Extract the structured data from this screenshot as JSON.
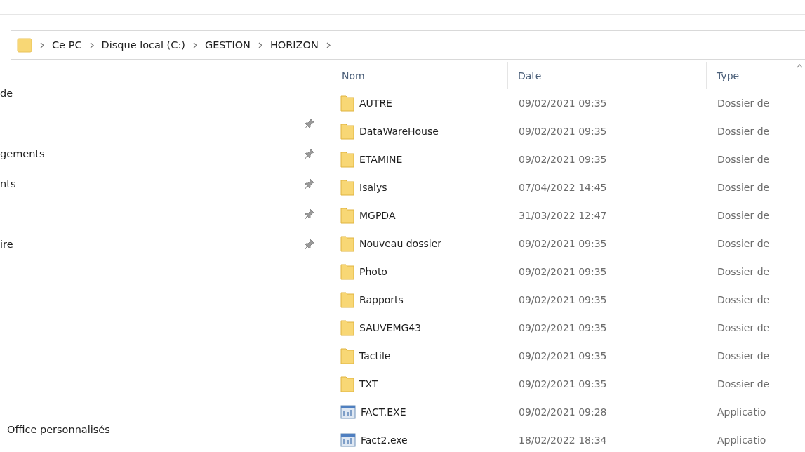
{
  "address_bar": {
    "path": [
      "Ce PC",
      "Disque local (C:)",
      "GESTION",
      "HORIZON"
    ]
  },
  "sidebar": {
    "items": [
      {
        "label": "de",
        "pinned": false
      },
      {
        "pinned": true
      },
      {
        "label": "gements",
        "pinned": true
      },
      {
        "label": "nts",
        "pinned": true
      },
      {
        "pinned": true
      },
      {
        "label": "ire",
        "pinned": true
      },
      {
        "label": "Office personnalisés",
        "pinned": false
      }
    ]
  },
  "file_list": {
    "columns": [
      "Nom",
      "Date",
      "Type"
    ],
    "rows": [
      {
        "kind": "folder",
        "name": "AUTRE",
        "date": "09/02/2021 09:35",
        "type": "Dossier de"
      },
      {
        "kind": "folder",
        "name": "DataWareHouse",
        "date": "09/02/2021 09:35",
        "type": "Dossier de"
      },
      {
        "kind": "folder",
        "name": "ETAMINE",
        "date": "09/02/2021 09:35",
        "type": "Dossier de"
      },
      {
        "kind": "folder",
        "name": "Isalys",
        "date": "07/04/2022 14:45",
        "type": "Dossier de"
      },
      {
        "kind": "folder",
        "name": "MGPDA",
        "date": "31/03/2022 12:47",
        "type": "Dossier de"
      },
      {
        "kind": "folder",
        "name": "Nouveau dossier",
        "date": "09/02/2021 09:35",
        "type": "Dossier de"
      },
      {
        "kind": "folder",
        "name": "Photo",
        "date": "09/02/2021 09:35",
        "type": "Dossier de"
      },
      {
        "kind": "folder",
        "name": "Rapports",
        "date": "09/02/2021 09:35",
        "type": "Dossier de"
      },
      {
        "kind": "folder",
        "name": "SAUVEMG43",
        "date": "09/02/2021 09:35",
        "type": "Dossier de"
      },
      {
        "kind": "folder",
        "name": "Tactile",
        "date": "09/02/2021 09:35",
        "type": "Dossier de"
      },
      {
        "kind": "folder",
        "name": "TXT",
        "date": "09/02/2021 09:35",
        "type": "Dossier de"
      },
      {
        "kind": "application",
        "name": "FACT.EXE",
        "date": "09/02/2021 09:28",
        "type": "Applicatio"
      },
      {
        "kind": "application",
        "name": "Fact2.exe",
        "date": "18/02/2022 18:34",
        "type": "Applicatio"
      }
    ]
  }
}
